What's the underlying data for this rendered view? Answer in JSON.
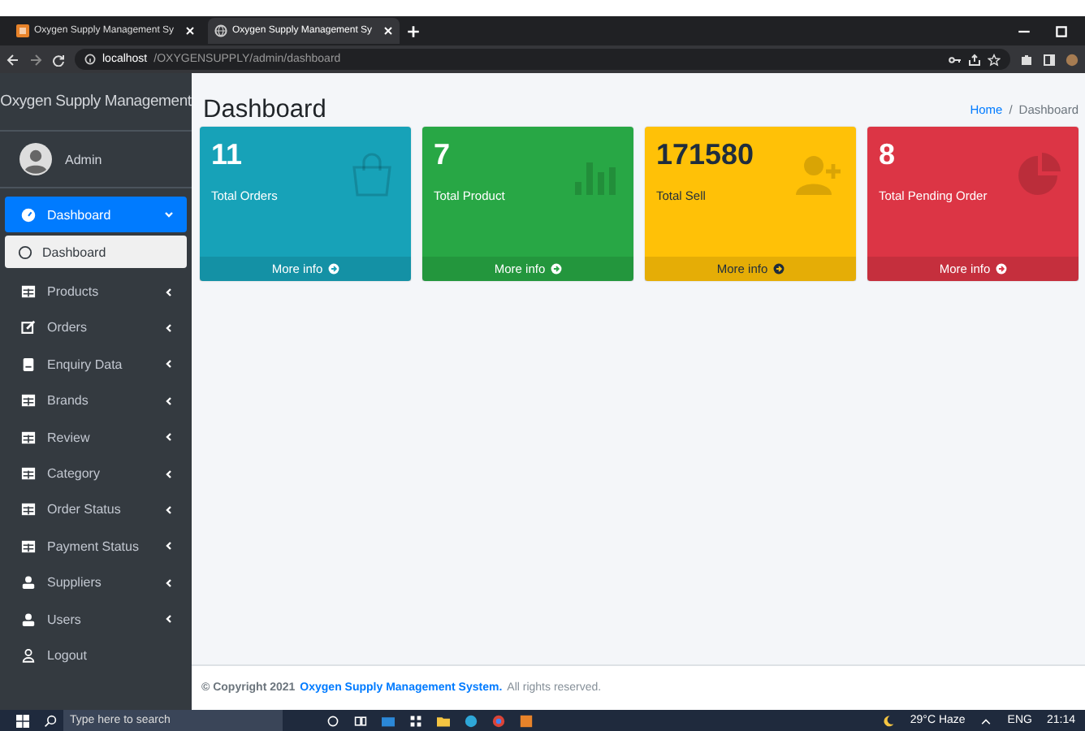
{
  "browser": {
    "tabs": [
      {
        "title": "Oxygen Supply Management Sy",
        "selected": false
      },
      {
        "title": "Oxygen Supply Management Sy",
        "selected": true
      }
    ],
    "address": {
      "host": "localhost",
      "path": "/OXYGENSUPPLY/admin/dashboard"
    }
  },
  "sidebar": {
    "brand": "Oxygen Supply Management",
    "user": "Admin",
    "menu": [
      {
        "label": "Dashboard",
        "kind": "gauge",
        "selected": true,
        "expanded": true,
        "children": [
          {
            "label": "Dashboard",
            "selected": true
          }
        ]
      },
      {
        "label": "Products",
        "kind": "table",
        "selected": false,
        "expanded": false
      },
      {
        "label": "Orders",
        "kind": "edit",
        "selected": false,
        "expanded": false
      },
      {
        "label": "Enquiry Data",
        "kind": "doc",
        "selected": false,
        "expanded": false
      },
      {
        "label": "Brands",
        "kind": "table",
        "selected": false,
        "expanded": false
      },
      {
        "label": "Review",
        "kind": "table",
        "selected": false,
        "expanded": false
      },
      {
        "label": "Category",
        "kind": "table",
        "selected": false,
        "expanded": false
      },
      {
        "label": "Order Status",
        "kind": "table",
        "selected": false,
        "expanded": false
      },
      {
        "label": "Payment Status",
        "kind": "table",
        "selected": false,
        "expanded": false
      },
      {
        "label": "Suppliers",
        "kind": "user",
        "selected": false,
        "expanded": false
      },
      {
        "label": "Users",
        "kind": "user",
        "selected": false,
        "expanded": false
      },
      {
        "label": "Logout",
        "kind": "logout",
        "selected": false
      }
    ]
  },
  "header": {
    "title": "Dashboard",
    "separator": "/",
    "breadcrumb": [
      {
        "label": "Home",
        "kind": "link"
      },
      {
        "label": "Dashboard",
        "kind": "current"
      }
    ]
  },
  "cards": [
    {
      "value": "11",
      "label": "Total Orders",
      "link": "More info",
      "color": "#17a2b8",
      "kind": "bag"
    },
    {
      "value": "7",
      "label": "Total Product",
      "link": "More info",
      "color": "#28a745",
      "kind": "bars"
    },
    {
      "value": "171580",
      "label": "Total Sell",
      "link": "More info",
      "color": "#ffc107",
      "kind": "user-plus"
    },
    {
      "value": "8",
      "label": "Total Pending Order",
      "link": "More info",
      "color": "#dc3545",
      "kind": "pie"
    }
  ],
  "footer": {
    "prefix": "© Copyright 2021",
    "link": "Oxygen Supply Management System.",
    "suffix": "All rights reserved."
  },
  "taskbar": {
    "search": {
      "placeholder": "Type here to search"
    },
    "weather": "29°C Haze",
    "language": "ENG",
    "time": "21:14"
  }
}
